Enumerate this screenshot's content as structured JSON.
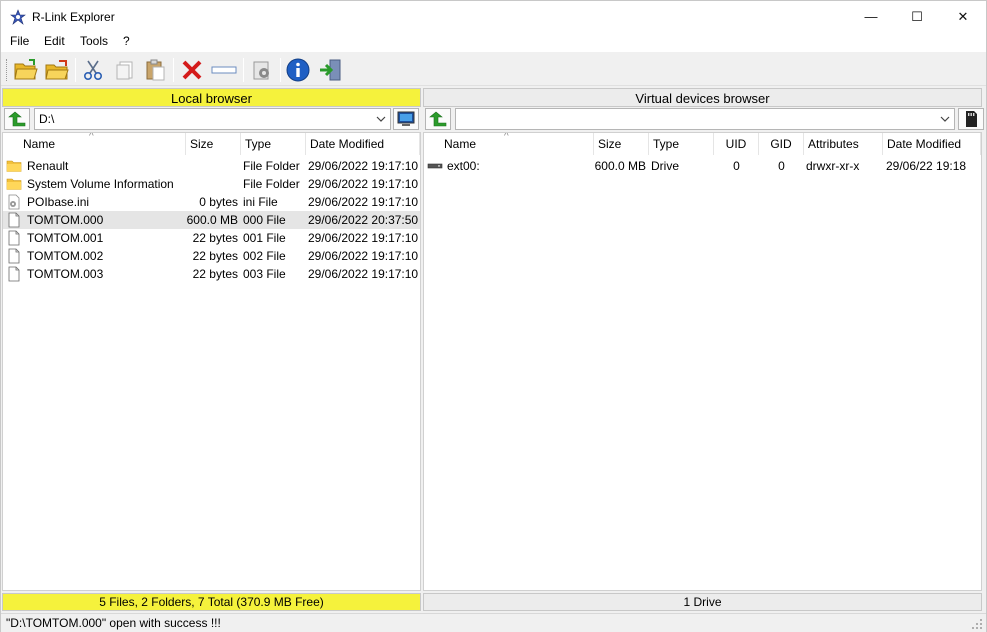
{
  "window": {
    "title": "R-Link Explorer",
    "controls": {
      "minimize": "—",
      "maximize": "☐",
      "close": "✕"
    }
  },
  "menu": [
    "File",
    "Edit",
    "Tools",
    "?"
  ],
  "toolbar": {
    "icons": [
      "open-folder-icon",
      "open-archive-icon",
      "cut-icon",
      "copy-icon",
      "paste-icon",
      "delete-icon",
      "rename-icon",
      "properties-icon",
      "info-icon",
      "exit-icon"
    ]
  },
  "left": {
    "header": "Local browser",
    "path": "D:\\",
    "columns": [
      "Name",
      "Size",
      "Type",
      "Date Modified"
    ],
    "rows": [
      {
        "name": "Renault",
        "size": "",
        "type": "File Folder",
        "date": "29/06/2022 19:17:10",
        "icon": "folder-icon"
      },
      {
        "name": "System Volume Information",
        "size": "",
        "type": "File Folder",
        "date": "29/06/2022 19:17:10",
        "icon": "folder-icon"
      },
      {
        "name": "POIbase.ini",
        "size": "0 bytes",
        "type": "ini File",
        "date": "29/06/2022 19:17:10",
        "icon": "ini-file-icon"
      },
      {
        "name": "TOMTOM.000",
        "size": "600.0 MB",
        "type": "000 File",
        "date": "29/06/2022 20:37:50",
        "icon": "file-icon",
        "selected": true
      },
      {
        "name": "TOMTOM.001",
        "size": "22 bytes",
        "type": "001 File",
        "date": "29/06/2022 19:17:10",
        "icon": "file-icon"
      },
      {
        "name": "TOMTOM.002",
        "size": "22 bytes",
        "type": "002 File",
        "date": "29/06/2022 19:17:10",
        "icon": "file-icon"
      },
      {
        "name": "TOMTOM.003",
        "size": "22 bytes",
        "type": "003 File",
        "date": "29/06/2022 19:17:10",
        "icon": "file-icon"
      }
    ],
    "status": "5 Files, 2 Folders, 7 Total (370.9 MB Free)"
  },
  "right": {
    "header": "Virtual devices browser",
    "path": "",
    "columns": [
      "Name",
      "Size",
      "Type",
      "UID",
      "GID",
      "Attributes",
      "Date Modified"
    ],
    "rows": [
      {
        "name": "ext00:",
        "size": "600.0 MB",
        "type": "Drive",
        "uid": "0",
        "gid": "0",
        "attr": "drwxr-xr-x",
        "date": "29/06/22 19:18",
        "icon": "drive-icon"
      }
    ],
    "status": "1 Drive"
  },
  "statusbar": {
    "message": "\"D:\\TOMTOM.000\" open with success !!!"
  },
  "colors": {
    "panel_active": "#f5f23c",
    "panel_inactive": "#ececec"
  }
}
